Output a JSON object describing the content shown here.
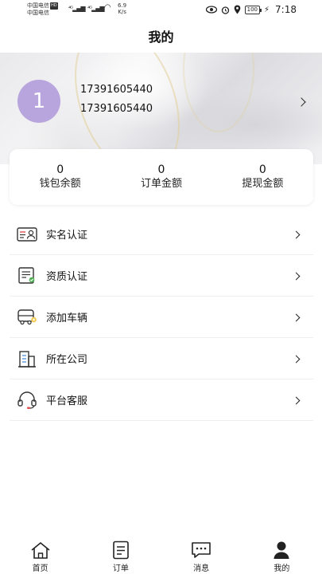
{
  "status_bar": {
    "carrier_line1": "中国电信",
    "carrier_badge": "HD",
    "carrier_line2": "中国电信",
    "net_speed_value": "6.9",
    "net_speed_unit": "K/s",
    "battery": "100",
    "time": "7:18"
  },
  "header": {
    "title": "我的"
  },
  "profile": {
    "avatar_text": "1",
    "phone_primary": "17391605440",
    "phone_secondary": "17391605440"
  },
  "stats": [
    {
      "value": "0",
      "label": "钱包余额"
    },
    {
      "value": "0",
      "label": "订单金额"
    },
    {
      "value": "0",
      "label": "提现金额"
    }
  ],
  "menu": [
    {
      "label": "实名认证",
      "icon": "id-card-icon"
    },
    {
      "label": "资质认证",
      "icon": "certificate-icon"
    },
    {
      "label": "添加车辆",
      "icon": "bus-icon"
    },
    {
      "label": "所在公司",
      "icon": "building-icon"
    },
    {
      "label": "平台客服",
      "icon": "headset-icon"
    }
  ],
  "bottom_nav": [
    {
      "label": "首页",
      "icon": "home-icon"
    },
    {
      "label": "订单",
      "icon": "order-icon"
    },
    {
      "label": "消息",
      "icon": "message-icon"
    },
    {
      "label": "我的",
      "icon": "profile-icon",
      "active": true
    }
  ],
  "colors": {
    "avatar": "#b9a5dd",
    "accent_red": "#e05050",
    "accent_green": "#4caf50"
  }
}
